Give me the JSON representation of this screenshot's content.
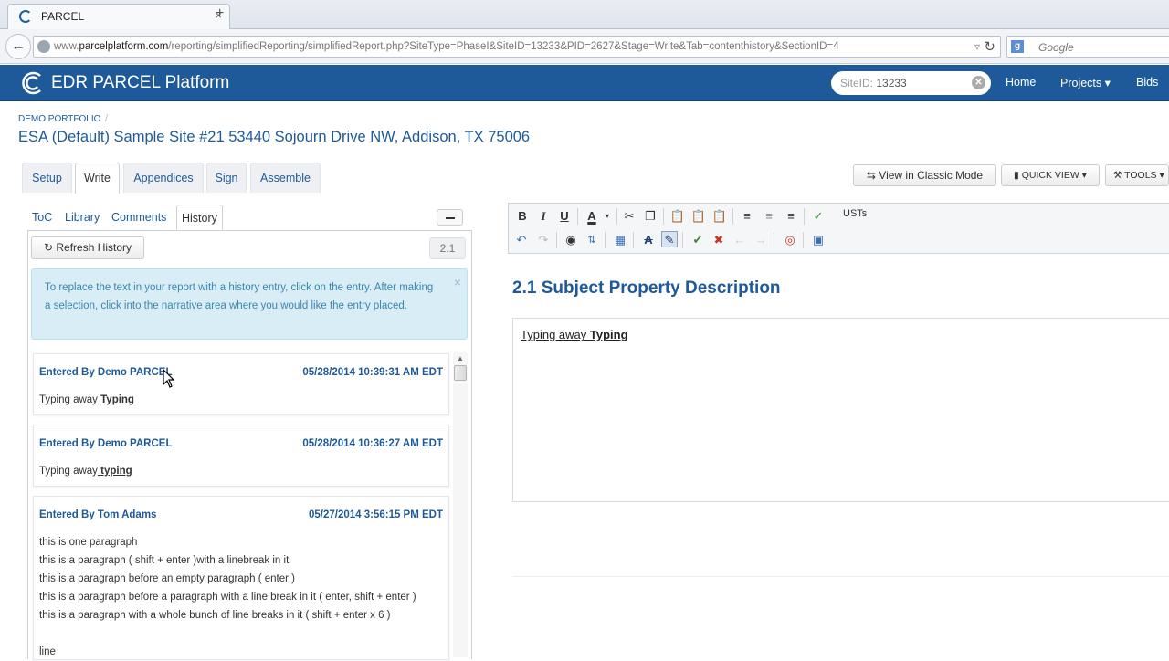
{
  "browser": {
    "tab_title": "PARCEL",
    "tab_close": "×",
    "new_tab": "+",
    "url_prefix": "www.",
    "url_domain": "parcelplatform.com",
    "url_path": "/reporting/simplifiedReporting/simplifiedReport.php?SiteType=PhaseI&SiteID=13233&PID=2627&Stage=Write&Tab=contenthistory&SectionID=4",
    "search_placeholder": "Google"
  },
  "header": {
    "brand": "EDR PARCEL Platform",
    "siteid_label": "SiteID:",
    "siteid_value": "13233",
    "nav": [
      "Home",
      "Projects ▾",
      "Bids"
    ]
  },
  "breadcrumb": "DEMO PORTFOLIO",
  "breadcrumb_sep": "/",
  "page_title": "ESA (Default) Sample Site #21 53440 Sojourn Drive NW, Addison, TX 75006",
  "main_tabs": [
    "Setup",
    "Write",
    "Appendices",
    "Sign",
    "Assemble"
  ],
  "actions": {
    "classic_mode": "View in Classic Mode",
    "quick_view": "QUICK VIEW",
    "tools": "TOOLS"
  },
  "left_tabs": [
    "ToC",
    "Library",
    "Comments",
    "History"
  ],
  "refresh_history": "Refresh History",
  "section_number": "2.1",
  "info_message": "To replace the text in your report with a history entry, click on the entry. After making a selection, click into the narrative area where you would like the entry placed.",
  "history": [
    {
      "who": "Entered By Demo PARCEL",
      "when": "05/28/2014 10:39:31 AM EDT",
      "plain": "Typing away ",
      "bold": "Typing"
    },
    {
      "who": "Entered By Demo PARCEL",
      "when": "05/28/2014 10:36:27 AM EDT",
      "plain": "Typing away",
      "bold": " typing"
    },
    {
      "who": "Entered By Tom Adams",
      "when": "05/27/2014 3:56:15 PM EDT",
      "lines": [
        "this is one paragraph",
        "this is a paragraph ( shift + enter )with a linebreak in it",
        "this is a paragraph before an empty paragraph ( enter )",
        "this is a paragraph before a paragraph with a line break in it ( enter, shift + enter )",
        "this is a paragraph with a whole bunch of line breaks in it ( shift + enter x 6 )",
        "",
        "line"
      ]
    }
  ],
  "editor": {
    "toolbar_label": "USTs",
    "section_heading": "2.1 Subject Property Description",
    "content_plain": "Typing away ",
    "content_bold": "Typing"
  },
  "colors": {
    "brand_blue": "#1e5a99",
    "info_bg": "#d9edf7",
    "info_text": "#3a87ad"
  }
}
